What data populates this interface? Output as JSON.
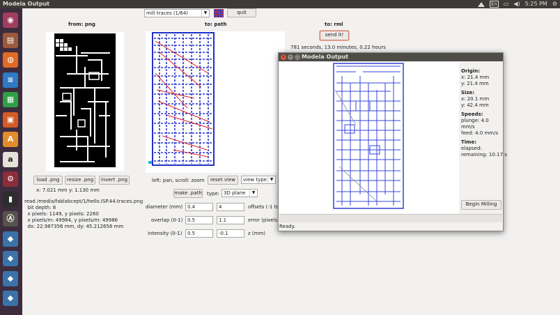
{
  "topbar": {
    "title": "Modela Output",
    "kbd": "En",
    "time": "5:25 PM",
    "icons": [
      "wifi-icon",
      "keyboard-icon",
      "battery-icon",
      "volume-icon",
      "clock-text",
      "settings-icon"
    ]
  },
  "launcher": {
    "icons": [
      {
        "name": "ubuntu-dash-icon",
        "color": "#a13d5d",
        "glyph": "◉"
      },
      {
        "name": "files-icon",
        "color": "#9b5a3c",
        "glyph": "▤"
      },
      {
        "name": "firefox-icon",
        "color": "#e06b25",
        "glyph": "◍"
      },
      {
        "name": "writer-icon",
        "color": "#2f79c5",
        "glyph": "≡"
      },
      {
        "name": "calc-icon",
        "color": "#2f9e44",
        "glyph": "▦"
      },
      {
        "name": "impress-icon",
        "color": "#d35b27",
        "glyph": "▣"
      },
      {
        "name": "software-center-icon",
        "color": "#e28c2b",
        "glyph": "A"
      },
      {
        "name": "amazon-icon",
        "color": "#e6e2d9",
        "glyph": "a"
      },
      {
        "name": "settings-icon",
        "color": "#8b2e3a",
        "glyph": "⚙"
      },
      {
        "name": "terminal-icon",
        "color": "#2d2d2d",
        "glyph": "▮"
      },
      {
        "name": "updater-icon",
        "color": "#56524c",
        "glyph": "Ⓐ"
      },
      {
        "name": "python-icon-1",
        "color": "#3b73a8",
        "glyph": "◆"
      },
      {
        "name": "python-icon-2",
        "color": "#3b73a8",
        "glyph": "◆"
      },
      {
        "name": "python-icon-3",
        "color": "#3b73a8",
        "glyph": "◆"
      },
      {
        "name": "python-icon-4",
        "color": "#3b73a8",
        "glyph": "◆"
      }
    ]
  },
  "app": {
    "process_select": "mill traces (1/64)",
    "quit": "quit",
    "headers": {
      "from": "from: png",
      "to_path": "to: path",
      "to_rml": "to: rml"
    },
    "send": "send it!",
    "estimate": "781 seconds, 13.0 minutes, 0.22 hours",
    "buttons": {
      "load": "load .png",
      "resize": "resize .png",
      "invert": "invert .png",
      "make_path": "make .path",
      "reset_view": "reset view"
    },
    "view_type": "view type",
    "coords": "x: 7.021 mm  y: 1.130 mm",
    "pan_hint": "left: pan, scroll: zoom",
    "type_label": "type:",
    "type_value": "3D plane",
    "info": [
      "read /media/fablabcept/1/hello.ISP.44.traces.png",
      "  bit depth: 8",
      "  x pixels: 1149, y pixels: 2260",
      "  x pixels/m: 49984, y pixels/m: 49986",
      "  dx: 22.987356 mm, dy: 45.212658 mm"
    ],
    "params": [
      {
        "label": "diameter (mm)",
        "v1": "0.4",
        "v2": "4",
        "right": "offsets (-1 to"
      },
      {
        "label": "overlap (0-1)",
        "v1": "0.5",
        "v2": "1.1",
        "right": "error (pixels)"
      },
      {
        "label": "intensity (0-1)",
        "v1": "0.5",
        "v2": "-0.1",
        "right": "z (mm)"
      }
    ]
  },
  "dialog": {
    "title": "Modela Output",
    "origin_h": "Origin:",
    "origin_x": "x: 21.4 mm",
    "origin_y": "y: 21.4 mm",
    "size_h": "Size:",
    "size_x": "x: 20.1 mm",
    "size_y": "y: 42.4 mm",
    "speeds_h": "Speeds:",
    "plunge": "plunge: 4.0 mm/s",
    "feed": "feed: 4.0 mm/s",
    "time_h": "Time:",
    "elapsed": "elapsed:",
    "remaining": "remaining: 10:17 s",
    "begin": "Begin Milling",
    "status": "Ready."
  }
}
